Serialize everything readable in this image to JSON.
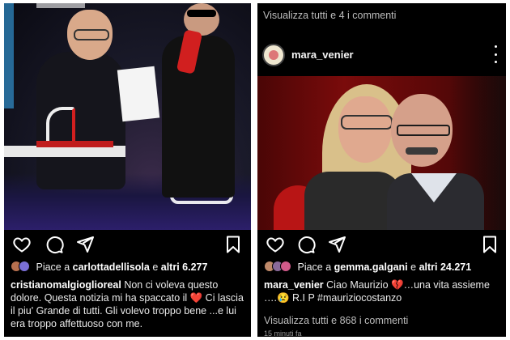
{
  "left_post": {
    "likes": {
      "prefix": "Piace a ",
      "user": "carlottadellisola",
      "joiner": " e ",
      "others": "altri 6.277"
    },
    "caption": {
      "username": "cristianomalgioglioreal",
      "text": " Non ci voleva questo dolore. Questa notizia mi ha spaccato il ❤️ Ci lascia il piu' Grande di tutti. Gli volevo troppo bene ...e lui era troppo affettuoso con me."
    }
  },
  "right_post": {
    "top_comments": "Visualizza tutti e 4 i commenti",
    "username": "mara_venier",
    "likes": {
      "prefix": "Piace a ",
      "user": "gemma.galgani",
      "joiner": " e ",
      "others": "altri 24.271"
    },
    "caption": {
      "username": "mara_venier",
      "text": " Ciao Maurizio 💔…una vita assieme ….😢 R.I P #mauriziocostanzo"
    },
    "view_comments": "Visualizza tutti e 868 i commenti",
    "timestamp": "15 minuti fa"
  },
  "icons": [
    "heart-icon",
    "comment-icon",
    "share-icon",
    "bookmark-icon",
    "more-options-icon"
  ],
  "colors": {
    "background": "#000000",
    "text": "#f5f5f5",
    "muted": "#bdbdbd"
  }
}
